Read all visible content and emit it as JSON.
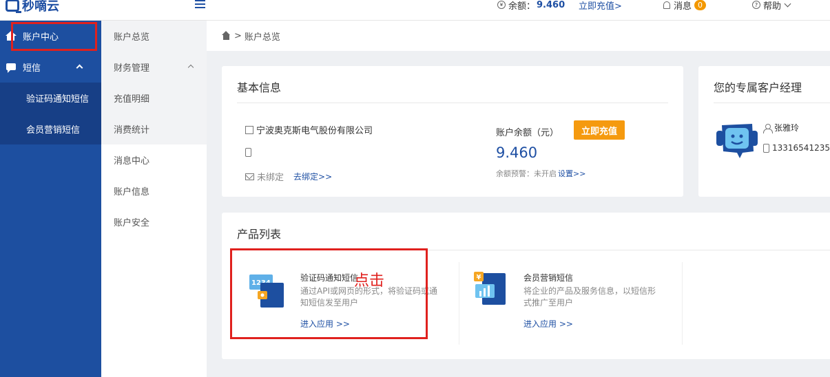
{
  "header": {
    "logo_text": "秒嘀云",
    "balance_label": "余额：",
    "balance_value": "9.460",
    "recharge_link": "立即充值>",
    "messages_label": "消息",
    "messages_count": "0",
    "help_label": "帮助"
  },
  "sidebar": {
    "items": [
      {
        "label": "账户中心",
        "icon": "home-icon"
      },
      {
        "label": "短信",
        "icon": "sms-icon"
      }
    ],
    "sub_items": [
      {
        "label": "验证码通知短信"
      },
      {
        "label": "会员营销短信"
      }
    ]
  },
  "sidebar2": {
    "items": [
      {
        "label": "账户总览"
      },
      {
        "label": "财务管理"
      },
      {
        "label": "充值明细"
      },
      {
        "label": "消费统计"
      },
      {
        "label": "消息中心"
      },
      {
        "label": "账户信息"
      },
      {
        "label": "账户安全"
      }
    ]
  },
  "breadcrumb": {
    "separator": ">",
    "current": "账户总览"
  },
  "basic_info": {
    "title": "基本信息",
    "company": "宁波奥克斯电气股份有限公司",
    "phone": "",
    "email_status": "未绑定",
    "bind_link": "去绑定>>",
    "balance_label": "账户余额（元）",
    "recharge_button": "立即充值",
    "balance_value": "9.460",
    "warning_label": "余额预警：未开启",
    "settings_link": "设置>>"
  },
  "manager": {
    "title": "您的专属客户经理",
    "name": "张雅玲",
    "phone": "13316541235"
  },
  "products": {
    "title": "产品列表",
    "items": [
      {
        "name": "验证码通知短信",
        "icon_text": "1234",
        "desc_line1": "通过API或网页的形式，将验证码或通",
        "desc_line2": "知短信发至用户",
        "link": "进入应用 >>"
      },
      {
        "name": "会员营销短信",
        "icon_text": "¥",
        "desc_line1": "将企业的产品及服务信息，以短信形",
        "desc_line2": "式推广至用户",
        "link": "进入应用 >>"
      }
    ]
  },
  "annotation": {
    "text": "点击",
    "color": "#e0211e"
  },
  "colors": {
    "brand": "#1d4fa0",
    "accent": "#f59a0f",
    "annotation": "#e0211e"
  }
}
